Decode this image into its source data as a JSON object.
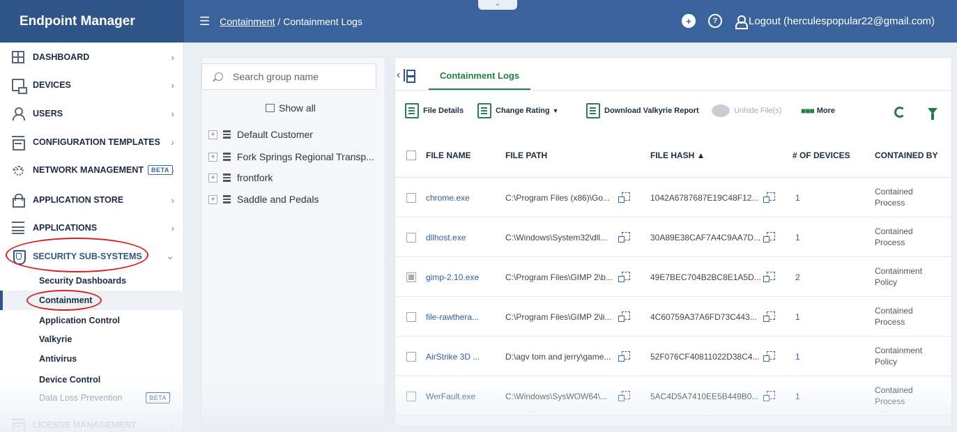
{
  "app": {
    "title": "Endpoint Manager"
  },
  "header": {
    "breadcrumb_link": "Containment",
    "breadcrumb_sep": " / ",
    "breadcrumb_current": "Containment Logs",
    "logout_label": "Logout (herculespopular22@gmail.com)",
    "handle_glyph": "⌄"
  },
  "sidebar": {
    "items": [
      {
        "label": "DASHBOARD",
        "icon": "grid-icon"
      },
      {
        "label": "DEVICES",
        "icon": "device-icon"
      },
      {
        "label": "USERS",
        "icon": "user-icon"
      },
      {
        "label": "CONFIGURATION TEMPLATES",
        "icon": "config-icon"
      },
      {
        "label": "NETWORK MANAGEMENT",
        "icon": "network-icon",
        "badge": "BETA"
      },
      {
        "label": "APPLICATION STORE",
        "icon": "store-icon"
      },
      {
        "label": "APPLICATIONS",
        "icon": "apps-icon"
      },
      {
        "label": "SECURITY SUB-SYSTEMS",
        "icon": "shield-icon"
      }
    ],
    "sub_items": [
      {
        "label": "Security Dashboards"
      },
      {
        "label": "Containment"
      },
      {
        "label": "Application Control"
      },
      {
        "label": "Valkyrie"
      },
      {
        "label": "Antivirus"
      },
      {
        "label": "Device Control"
      },
      {
        "label": "Data Loss Prevention",
        "badge": "BETA"
      }
    ],
    "last_item": "LICENSE MANAGEMENT"
  },
  "groups": {
    "search_placeholder": "Search group name",
    "show_all": "Show all",
    "tree": [
      "Default Customer",
      "Fork Springs Regional Transp...",
      "frontfork",
      "Saddle and Pedals"
    ]
  },
  "main": {
    "tab": "Containment Logs",
    "toolbar": {
      "file_details": "File Details",
      "change_rating": "Change Rating",
      "download_report": "Download Valkyrie Report",
      "unhide": "Unhide File(s)",
      "more": "More"
    },
    "columns": {
      "file_name": "FILE NAME",
      "file_path": "FILE PATH",
      "file_hash": "FILE HASH ▲",
      "devices": "# OF DEVICES",
      "contained_by": "CONTAINED BY"
    },
    "rows": [
      {
        "name": "chrome.exe",
        "path": "C:\\Program Files (x86)\\Go...",
        "hash": "1042A6787687E19C48F12...",
        "devices": "1",
        "by": "Contained Process",
        "checked": false
      },
      {
        "name": "dllhost.exe",
        "path": "C:\\Windows\\System32\\dll...",
        "hash": "30A89E38CAF7A4C9AA7D...",
        "devices": "1",
        "by": "Contained Process",
        "checked": false
      },
      {
        "name": "gimp-2.10.exe",
        "path": "C:\\Program Files\\GIMP 2\\b...",
        "hash": "49E7BEC704B2BC8E1A5D...",
        "devices": "2",
        "by": "Containment Policy",
        "checked": true
      },
      {
        "name": "file-rawthera...",
        "path": "C:\\Program Files\\GIMP 2\\li...",
        "hash": "4C60759A37A6FD73C443...",
        "devices": "1",
        "by": "Contained Process",
        "checked": false
      },
      {
        "name": "AirStrike 3D ...",
        "path": "D:\\agv tom and jerry\\game...",
        "hash": "52F076CF40811022D38C4...",
        "devices": "1",
        "by": "Containment Policy",
        "checked": false
      },
      {
        "name": "WerFault.exe",
        "path": "C:\\Windows\\SysWOW64\\...",
        "hash": "5AC4D5A7410EE5B449B0...",
        "devices": "1",
        "by": "Contained Process",
        "checked": false
      }
    ]
  },
  "colors": {
    "header_bg": "#3a639b",
    "brand_bg": "#2f5588",
    "accent_green": "#227e46",
    "link_blue": "#2f5d98",
    "highlight_red": "#d9201e"
  }
}
